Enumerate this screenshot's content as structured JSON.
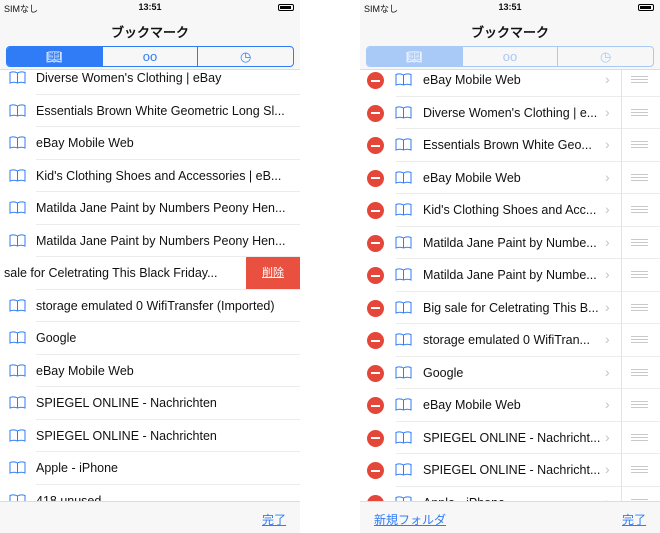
{
  "status": {
    "carrier": "SIMなし",
    "time": "13:51"
  },
  "title": "ブックマーク",
  "tabs": [
    {
      "icon": "book-icon"
    },
    {
      "icon": "reading-list-glasses-icon"
    },
    {
      "icon": "history-clock-icon"
    }
  ],
  "left": {
    "rows": [
      "Diverse Women's Clothing | eBay",
      "Essentials Brown White Geometric Long Sl...",
      "eBay Mobile Web",
      "Kid's Clothing Shoes and Accessories | eB...",
      "Matilda Jane Paint by Numbers Peony Hen...",
      "Matilda Jane Paint by Numbers Peony Hen...",
      "sale for Celetrating This Black Friday...",
      "storage emulated 0 WifiTransfer (Imported)",
      "Google",
      "eBay Mobile Web",
      "SPIEGEL ONLINE - Nachrichten",
      "SPIEGEL ONLINE - Nachrichten",
      "Apple - iPhone",
      "418 unused"
    ],
    "swiped_index": 6,
    "delete_label": "削除",
    "done_label": "完了"
  },
  "right": {
    "rows": [
      "eBay Mobile Web",
      "Diverse Women's Clothing | e...",
      "Essentials Brown White Geo...",
      "eBay Mobile Web",
      "Kid's Clothing Shoes and Acc...",
      "Matilda Jane Paint by Numbe...",
      "Matilda Jane Paint by Numbe...",
      "Big sale for Celetrating This B...",
      "storage emulated 0 WifiTran...",
      "Google",
      "eBay Mobile Web",
      "SPIEGEL ONLINE - Nachricht...",
      "SPIEGEL ONLINE - Nachricht...",
      "Apple - iPhone"
    ],
    "new_folder_label": "新規フォルダ",
    "done_label": "完了"
  },
  "colors": {
    "accent": "#2f7cf6",
    "delete": "#e9503f"
  }
}
